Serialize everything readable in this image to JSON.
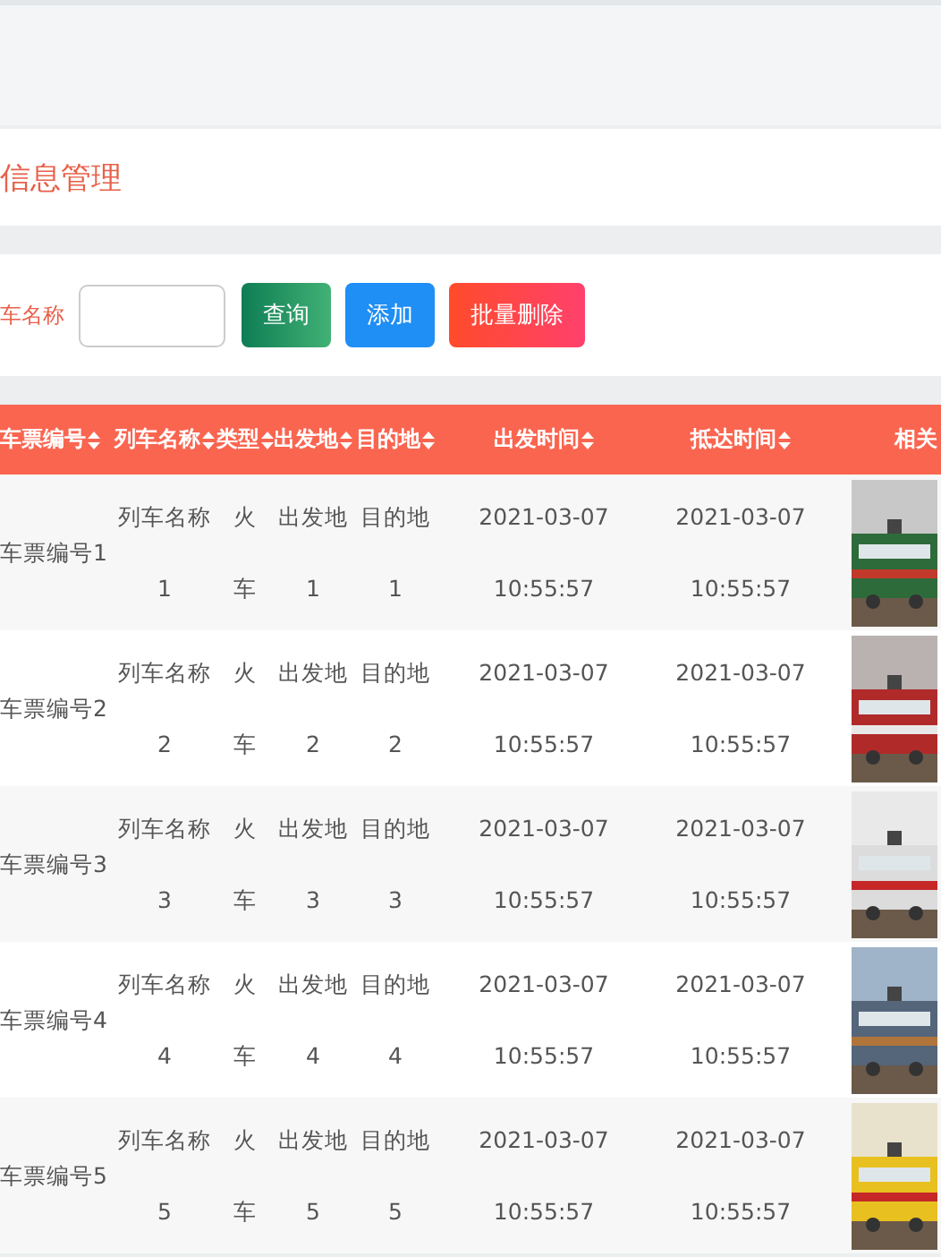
{
  "page_title": "信息管理",
  "search": {
    "label": "车名称"
  },
  "buttons": [
    {
      "label": "查询",
      "kind": "search"
    },
    {
      "label": "添加",
      "kind": "add"
    },
    {
      "label": "批量删除",
      "kind": "delete"
    }
  ],
  "table": {
    "columns": [
      {
        "label": "车票编号",
        "sortable": true
      },
      {
        "label": "列车名称",
        "sortable": true
      },
      {
        "label": "类型",
        "sortable": true
      },
      {
        "label": "出发地",
        "sortable": true
      },
      {
        "label": "目的地",
        "sortable": true
      },
      {
        "label": "出发时间",
        "sortable": true
      },
      {
        "label": "抵达时间",
        "sortable": true
      },
      {
        "label": "相关",
        "sortable": false
      }
    ],
    "rows": [
      {
        "cells": [
          "车票编号1",
          "列车名称1",
          "火车",
          "出发地1",
          "目的地1",
          "2021-03-07 10:55:57",
          "2021-03-07 10:55:57"
        ],
        "picture": {
          "kind": "picture"
        }
      },
      {
        "cells": [
          "车票编号2",
          "列车名称2",
          "火车",
          "出发地2",
          "目的地2",
          "2021-03-07 10:55:57",
          "2021-03-07 10:55:57"
        ],
        "picture": {
          "kind": "picture"
        }
      },
      {
        "cells": [
          "车票编号3",
          "列车名称3",
          "火车",
          "出发地3",
          "目的地3",
          "2021-03-07 10:55:57",
          "2021-03-07 10:55:57"
        ],
        "picture": {
          "kind": "picture"
        }
      },
      {
        "cells": [
          "车票编号4",
          "列车名称4",
          "火车",
          "出发地4",
          "目的地4",
          "2021-03-07 10:55:57",
          "2021-03-07 10:55:57"
        ],
        "picture": {
          "kind": "picture"
        }
      },
      {
        "cells": [
          "车票编号5",
          "列车名称5",
          "火车",
          "出发地5",
          "目的地5",
          "2021-03-07 10:55:57",
          "2021-03-07 10:55:57"
        ],
        "picture": {
          "kind": "picture"
        }
      }
    ]
  }
}
